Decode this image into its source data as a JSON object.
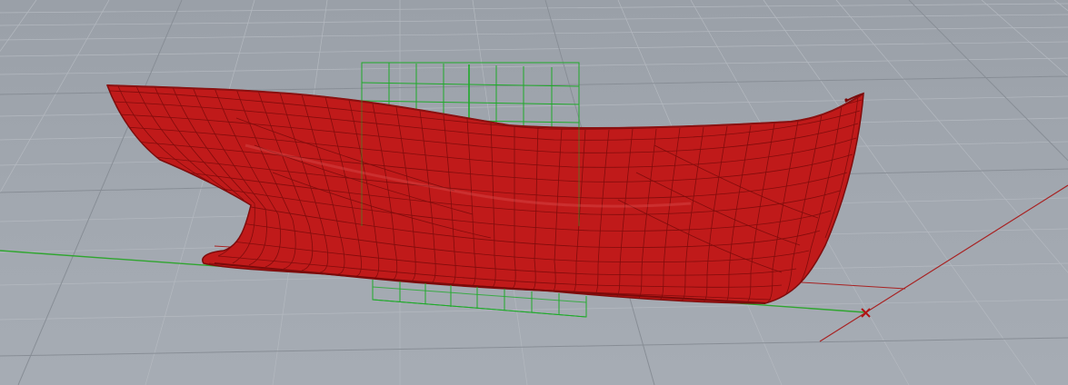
{
  "viewport": {
    "background_color": "#a0a6ae",
    "grid_minor_color": "#b4b9c0",
    "grid_major_color": "#878d95",
    "x_axis_color": "#2fa52f",
    "y_axis_color": "#a82222",
    "hull_color": "#c01a1a",
    "hull_wire_color": "#7e0c0c",
    "construction_plane_color": "#1faa2a",
    "origin_marker_icon": "origin-cross-icon"
  }
}
